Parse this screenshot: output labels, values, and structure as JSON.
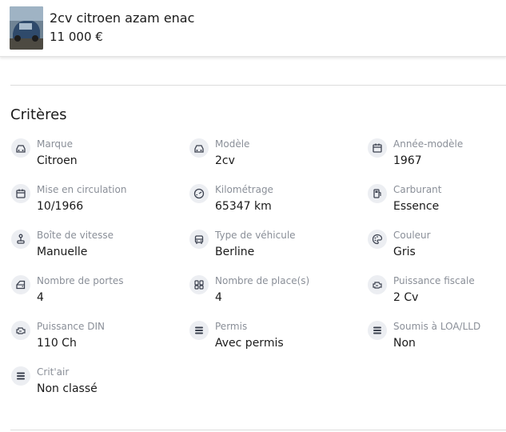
{
  "listing": {
    "title": "2cv citroen azam enac",
    "price": "11 000 €"
  },
  "section_title": "Critères",
  "criteria": [
    {
      "label": "Marque",
      "value": "Citroen",
      "icon": "car-icon"
    },
    {
      "label": "Modèle",
      "value": "2cv",
      "icon": "car-icon"
    },
    {
      "label": "Année-modèle",
      "value": "1967",
      "icon": "calendar-icon"
    },
    {
      "label": "Mise en circulation",
      "value": "10/1966",
      "icon": "calendar-icon"
    },
    {
      "label": "Kilométrage",
      "value": "65347 km",
      "icon": "speedometer-icon"
    },
    {
      "label": "Carburant",
      "value": "Essence",
      "icon": "fuel-pump-icon"
    },
    {
      "label": "Boîte de vitesse",
      "value": "Manuelle",
      "icon": "gear-shift-icon"
    },
    {
      "label": "Type de véhicule",
      "value": "Berline",
      "icon": "vehicle-front-icon"
    },
    {
      "label": "Couleur",
      "value": "Gris",
      "icon": "palette-icon"
    },
    {
      "label": "Nombre de portes",
      "value": "4",
      "icon": "car-door-icon"
    },
    {
      "label": "Nombre de place(s)",
      "value": "4",
      "icon": "seats-icon"
    },
    {
      "label": "Puissance fiscale",
      "value": "2 Cv",
      "icon": "engine-icon"
    },
    {
      "label": "Puissance DIN",
      "value": "110 Ch",
      "icon": "engine-icon"
    },
    {
      "label": "Permis",
      "value": "Avec permis",
      "icon": "list-icon"
    },
    {
      "label": "Soumis à LOA/LLD",
      "value": "Non",
      "icon": "list-icon"
    },
    {
      "label": "Crit'air",
      "value": "Non classé",
      "icon": "list-icon"
    }
  ],
  "colors": {
    "label": "#8a8f98",
    "value": "#1a1a1a",
    "icon_bg": "#eceef2",
    "icon_stroke": "#3c4250"
  }
}
